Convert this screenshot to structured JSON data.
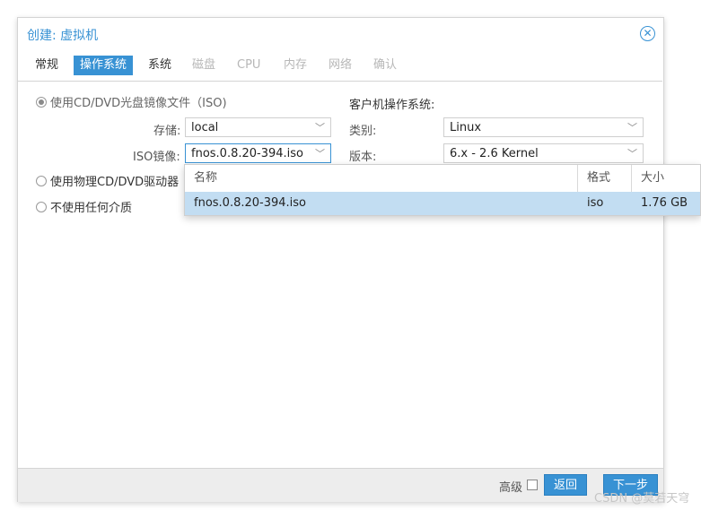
{
  "dialog": {
    "title": "创建: 虚拟机",
    "close_glyph": "✕"
  },
  "tabs": [
    {
      "label": "常规",
      "state": "normal"
    },
    {
      "label": "操作系统",
      "state": "active"
    },
    {
      "label": "系统",
      "state": "normal"
    },
    {
      "label": "磁盘",
      "state": "disabled"
    },
    {
      "label": "CPU",
      "state": "disabled"
    },
    {
      "label": "内存",
      "state": "disabled"
    },
    {
      "label": "网络",
      "state": "disabled"
    },
    {
      "label": "确认",
      "state": "disabled"
    }
  ],
  "media": {
    "option_iso": "使用CD/DVD光盘镜像文件（ISO)",
    "option_physical": "使用物理CD/DVD驱动器",
    "option_none": "不使用任何介质",
    "storage_label": "存储:",
    "storage_value": "local",
    "iso_label": "ISO镜像:",
    "iso_value": "fnos.0.8.20-394.iso"
  },
  "guest_os": {
    "heading": "客户机操作系统:",
    "type_label": "类别:",
    "type_value": "Linux",
    "version_label": "版本:",
    "version_value": "6.x - 2.6 Kernel"
  },
  "iso_dropdown": {
    "columns": [
      "名称",
      "格式",
      "大小"
    ],
    "rows": [
      {
        "name": "fnos.0.8.20-394.iso",
        "format": "iso",
        "size": "1.76 GB"
      }
    ]
  },
  "footer": {
    "advanced_label": "高级",
    "back_label": "返回",
    "next_label": "下一步"
  },
  "watermark": "CSDN @莫若天穹",
  "colors": {
    "accent": "#3892d4",
    "selection": "#c2ddf2"
  }
}
